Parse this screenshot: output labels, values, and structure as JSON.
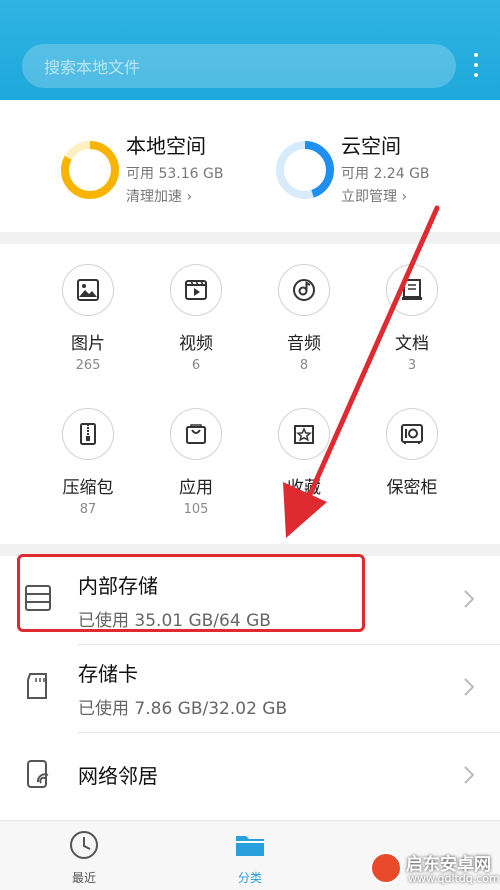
{
  "search": {
    "placeholder": "搜索本地文件"
  },
  "storage": {
    "local": {
      "title": "本地空间",
      "available": "可用 53.16 GB",
      "action": "清理加速 ›",
      "ring_color": "#f8b400",
      "used_fraction": 0.83
    },
    "cloud": {
      "title": "云空间",
      "available": "可用 2.24 GB",
      "action": "立即管理 ›",
      "ring_color": "#1f8ff0",
      "used_fraction": 0.45
    }
  },
  "categories": [
    {
      "label": "图片",
      "count": "265",
      "icon": "image-icon"
    },
    {
      "label": "视频",
      "count": "6",
      "icon": "video-icon"
    },
    {
      "label": "音频",
      "count": "8",
      "icon": "music-icon"
    },
    {
      "label": "文档",
      "count": "3",
      "icon": "document-icon"
    },
    {
      "label": "压缩包",
      "count": "87",
      "icon": "zip-icon"
    },
    {
      "label": "应用",
      "count": "105",
      "icon": "app-bag-icon"
    },
    {
      "label": "收藏",
      "count": "",
      "icon": "star-icon"
    },
    {
      "label": "保密柜",
      "count": "",
      "icon": "safe-icon"
    }
  ],
  "storage_list": [
    {
      "title": "内部存储",
      "sub": "已使用 35.01 GB/64 GB",
      "icon": "internal-storage-icon"
    },
    {
      "title": "存储卡",
      "sub": "已使用 7.86 GB/32.02 GB",
      "icon": "sd-card-icon"
    },
    {
      "title": "网络邻居",
      "sub": "",
      "icon": "network-icon"
    }
  ],
  "bottom_nav": [
    {
      "label": "最近",
      "icon": "clock-icon",
      "active": false
    },
    {
      "label": "分类",
      "icon": "folder-icon",
      "active": true
    }
  ],
  "colors": {
    "accent": "#1ea8db",
    "annotation": "#e02a32",
    "active_tab": "#2a9fde"
  },
  "watermark": {
    "title": "启东安卓网",
    "url": "www.qdltdq.com"
  }
}
